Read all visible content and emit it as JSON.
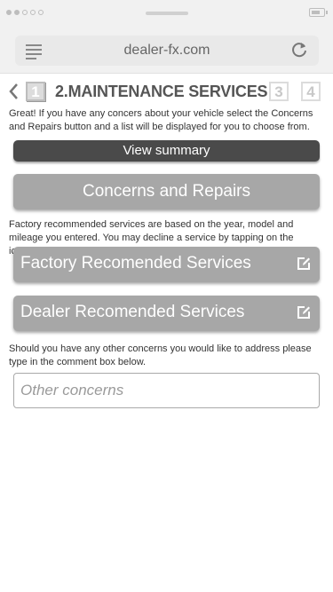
{
  "browser": {
    "url": "dealer-fx.com"
  },
  "header": {
    "current_step": "1",
    "title": "2.MAINTENANCE SERVICES",
    "step3": "3",
    "step4": "4"
  },
  "intro_text": "Great! If you have any concers about your vehicle select the Concerns and Repairs button and a list will be displayed for you to choose from.",
  "buttons": {
    "view_summary": "View summary",
    "concerns_repairs": "Concerns and Repairs",
    "factory_services": "Factory Recomended Services",
    "dealer_services": "Dealer Recomended Services"
  },
  "factory_note_before": "Factory recommended services are based on the year, model and mileage you entered. You may decline a service by tapping on the",
  "factory_note_after": "icon.",
  "concerns_note": "Should you have any other concerns you would like to address please type in the comment box below.",
  "comment": {
    "placeholder": "Other concerns"
  }
}
